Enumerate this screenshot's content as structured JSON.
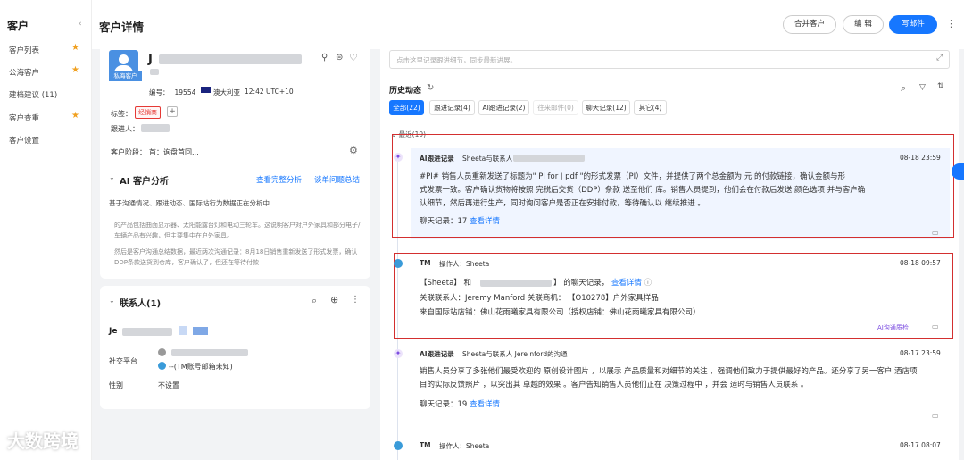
{
  "sidebar": {
    "title": "客户",
    "collapse": "‹",
    "items": [
      {
        "label": "客户列表",
        "star": true
      },
      {
        "label": "公海客户",
        "star": true
      },
      {
        "label": "建档建议 (11)",
        "star": false
      },
      {
        "label": "客户查重",
        "star": true
      },
      {
        "label": "客户设置",
        "star": false
      }
    ]
  },
  "header": {
    "title": "客户详情",
    "merge": "合并客户",
    "edit": "编 辑",
    "email": "写邮件",
    "more": "⋮"
  },
  "profile": {
    "name": "J",
    "avatar_tag": "私海客户",
    "id_label": "编号：",
    "id": "19554",
    "country": "澳大利亚",
    "time": "12:42 UTC+10",
    "tags_label": "标签：",
    "tag": "经销商",
    "add": "+",
    "follow_label": "跟进人：",
    "stage_label": "客户阶段：",
    "stage": "首：询盘首回..."
  },
  "ai": {
    "title": "AI 客户分析",
    "full": "查看完整分析",
    "summary": "谈单问题总结",
    "desc": "基于沟通情况、跟进动态、国际站行为数据正在分析中...",
    "p1": "的产品包括曲面显示器、太阳能露台灯和电动三轮车。这说明客户对户外家具和部分电子/车辆产品有兴趣，但主要集中在户外家具。",
    "p2": "然后是客户沟通总结数据，最近两次沟通记录：8月18日销售重新发送了形式发票，确认DDP条款送货到仓库，客户确认了，但还在等待付款"
  },
  "contacts": {
    "title": "联系人(1)",
    "name": "Je",
    "social_label": "社交平台",
    "social_value": "--(TM账号邮箱未知)",
    "gender_label": "性别",
    "gender_value": "不设置"
  },
  "timeline": {
    "placeholder": "点击这里记录跟进细节，同步最新进展。",
    "history": "历史动态",
    "tabs": [
      {
        "label": "全部(22)",
        "state": "active"
      },
      {
        "label": "跟进记录(4)",
        "state": ""
      },
      {
        "label": "AI跟进记录(2)",
        "state": ""
      },
      {
        "label": "往来邮件(0)",
        "state": "disabled"
      },
      {
        "label": "聊天记录(12)",
        "state": ""
      },
      {
        "label": "其它(4)",
        "state": ""
      }
    ],
    "recent": "最近(19)",
    "e1": {
      "type": "AI跟进记录",
      "who": "Sheeta与联系人",
      "date": "08-18 23:59",
      "line1": "#PI# 销售人员重新发送了标题为\" PI for J            pdf \"的形式发票（PI）文件，并提供了两个总金额为         元 的付款链接，确认金额与形",
      "line2": "式发票一致。客户确认货物将按照 完税后交货（DDP）条款 送至他们              库。销售人员提到，他们会在付款后发送 颜色选项 并与客户确",
      "line3": "认细节，然后再进行生产，同时询问客户是否正在安排付款，等待确认以 继续推进 。",
      "chat": "聊天记录：17",
      "detail": "查看详情"
    },
    "e2": {
      "type": "TM",
      "who": "操作人：Sheeta",
      "date": "08-18 09:57",
      "l1a": "【Sheeta】 和",
      "l1b": "】 的聊天记录，",
      "l1c": "查看详情",
      "l2": "关联联系人：Jeremy Manford        关联商机：  【O10278】户外家具样品",
      "l3": "来自国际站店铺：佛山花雨曦家具有限公司（授权店铺：佛山花雨曦家具有限公司）",
      "quality": "AI沟通质检"
    },
    "e3": {
      "type": "AI跟进记录",
      "who": "Sheeta与联系人 Jere      nford的沟通",
      "date": "08-17 23:59",
      "line1": "销售人员分享了多张他们最受欢迎的 原创设计图片 ，以展示 产品质量和对细节的关注 ，强调他们致力于提供最好的产品。还分享了另一客户 酒店项",
      "line2": "目的实际反馈照片 ，以突出其 卓越的效果 。客户告知销售人员他们正在 决策过程中 ，并会 适时与销售人员联系 。",
      "chat": "聊天记录：19",
      "detail": "查看详情"
    },
    "e4": {
      "type": "TM",
      "who": "操作人：Sheeta",
      "date": "08-17 08:07"
    }
  },
  "watermark": "大数跨境",
  "colors": {
    "primary": "#1677ff",
    "tag_red": "#e53935",
    "highlight": "#d32f2f",
    "star": "#f0a020"
  }
}
